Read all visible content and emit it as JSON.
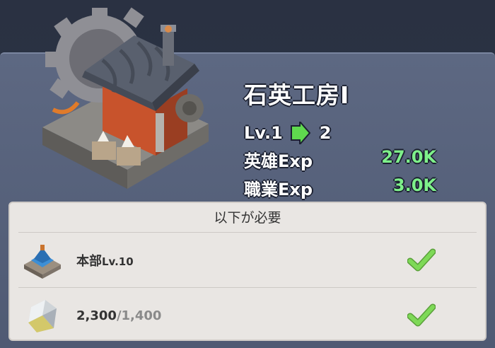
{
  "building": {
    "name": "石英工房Ⅰ",
    "level_from": "Lv.1",
    "level_to": "2",
    "icon": "quartz-workshop-building"
  },
  "stats": [
    {
      "label": "英雄Exp",
      "value": "27.0K"
    },
    {
      "label": "職業Exp",
      "value": "3.0K"
    }
  ],
  "requirements": {
    "header": "以下が必要",
    "items": [
      {
        "icon": "headquarters-building-icon",
        "label": "本部",
        "level": "Lv.10",
        "met": true
      },
      {
        "icon": "quartz-crystal-icon",
        "have": "2,300",
        "sep": "/",
        "need": "1,400",
        "met": true
      }
    ]
  },
  "colors": {
    "stat_value": "#7ef08a",
    "check": "#7ed957",
    "panel": "#5d6882"
  }
}
